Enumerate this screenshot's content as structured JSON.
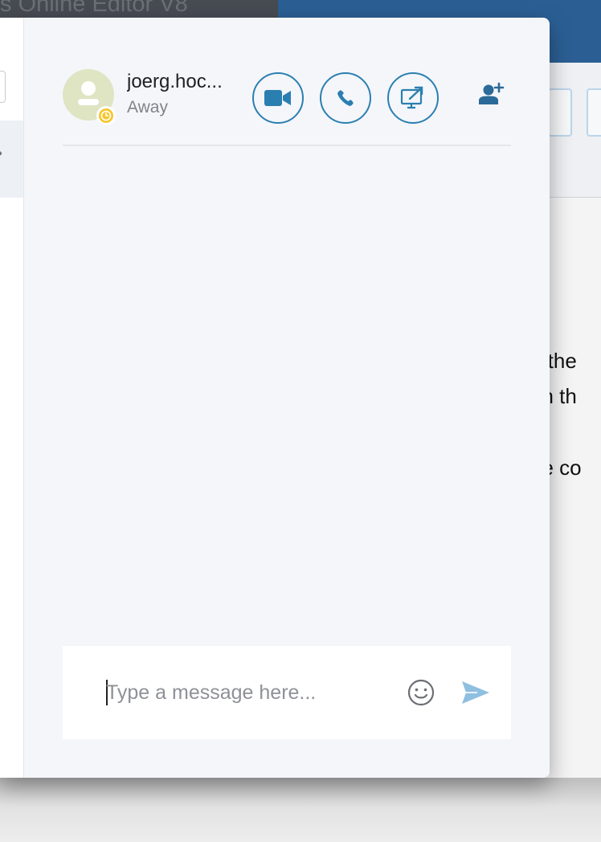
{
  "background_app": {
    "title": "s Online Editor V8",
    "doc_lines": [
      "o the",
      "on th",
      "he co"
    ]
  },
  "chat": {
    "contact": {
      "name": "joerg.hoc...",
      "status": "Away",
      "status_color": "#f7c62c",
      "avatar_color": "#dfe4c3"
    },
    "actions": {
      "video": "video-camera-icon",
      "call": "phone-icon",
      "share": "screen-share-icon",
      "add_user": "add-user-icon"
    },
    "composer": {
      "placeholder": "Type a message here...",
      "value": "",
      "emoji_icon": "smiley-icon",
      "send_icon": "send-icon"
    }
  },
  "colors": {
    "accent": "#2b7fb0",
    "panel_bg": "#f4f6fa",
    "send_icon": "#8fbfe0"
  }
}
